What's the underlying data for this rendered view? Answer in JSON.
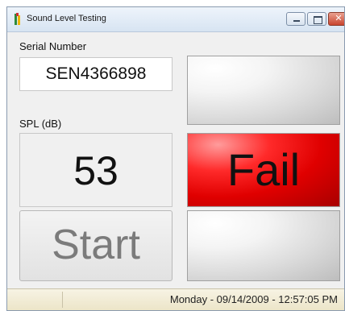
{
  "window": {
    "title": "Sound Level Testing"
  },
  "serial": {
    "label": "Serial Number",
    "value": "SEN4366898"
  },
  "spl": {
    "label": "SPL (dB)",
    "value": "53"
  },
  "start_button": {
    "label": "Start"
  },
  "indicators": {
    "top_state": "off",
    "middle_label": "Fail",
    "middle_color": "#e00000",
    "bottom_state": "off"
  },
  "status_bar": {
    "datetime": "Monday - 09/14/2009 - 12:57:05 PM"
  }
}
